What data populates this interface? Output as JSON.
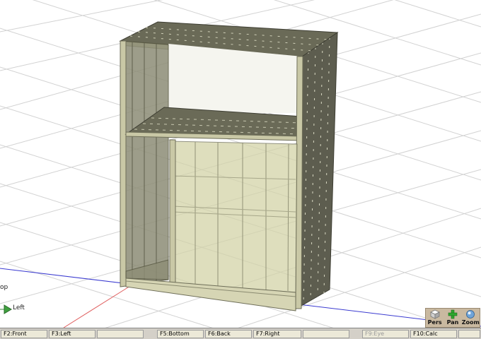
{
  "viewport": {
    "axis_labels": [
      "Left",
      "op"
    ]
  },
  "nav": {
    "pers_label": "Pers",
    "pan_label": "Pan",
    "zoom_label": "Zoom"
  },
  "function_keys": [
    {
      "label": "F2:Front",
      "enabled": true
    },
    {
      "label": "F3:Left",
      "enabled": true
    },
    {
      "label": "",
      "enabled": true
    },
    {
      "label": "F5:Bottom",
      "enabled": true
    },
    {
      "label": "F6:Back",
      "enabled": true
    },
    {
      "label": "F7:Right",
      "enabled": true
    },
    {
      "label": "",
      "enabled": true
    },
    {
      "label": "F9:Eye",
      "enabled": false
    },
    {
      "label": "F10:Calc",
      "enabled": true
    },
    {
      "label": "",
      "enabled": true
    }
  ],
  "colors": {
    "panel_light": "#c9c8a6",
    "panel_dark": "#5e5e4f",
    "glass": "#d6d6b0",
    "grid": "#cfcfcf",
    "axis_x": "#3a3ad0",
    "axis_y": "#e06060",
    "axis_z": "#40a040"
  }
}
